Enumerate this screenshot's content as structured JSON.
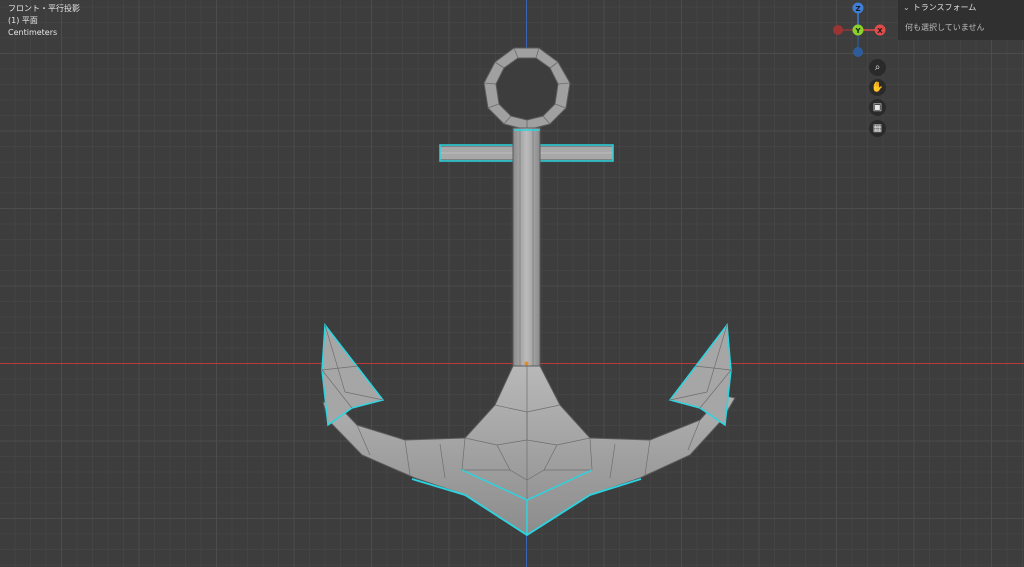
{
  "overlay": {
    "view_name": "フロント・平行投影",
    "object_name": "(1) 平面",
    "units": "Centimeters"
  },
  "gizmo": {
    "z_label": "Z",
    "y_label": "Y",
    "x_label": "X",
    "colors": {
      "x": "#e04b4b",
      "y": "#8ad22b",
      "z": "#3d7fd6"
    }
  },
  "nav_buttons": [
    {
      "icon": "zoom-icon",
      "glyph": "⌕"
    },
    {
      "icon": "hand-pan-icon",
      "glyph": "✋"
    },
    {
      "icon": "camera-icon",
      "glyph": "▣"
    },
    {
      "icon": "grid-icon",
      "glyph": "▦"
    }
  ],
  "npanel": {
    "title": "トランスフォーム",
    "message": "何も選択していません"
  },
  "colors": {
    "background": "#3d3d3d",
    "grid_minor": "#444444",
    "grid_major": "#4f4f4f",
    "x_axis": "#c83c3c",
    "z_axis": "#3c6ec8",
    "selection": "#2bd4e0",
    "mesh_fill": "#a3a3a3",
    "mesh_edge": "#5a5a5a"
  }
}
